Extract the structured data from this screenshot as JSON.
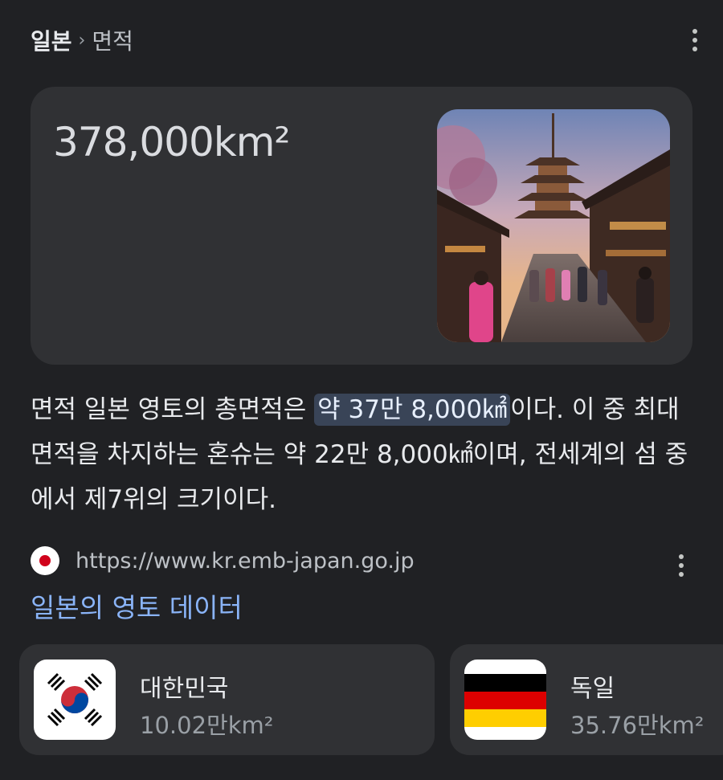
{
  "breadcrumb": {
    "root": "일본",
    "separator": "›",
    "current": "면적"
  },
  "hero": {
    "value": "378,000km²",
    "image_alt": "교토 야사카 탑 거리 사진"
  },
  "snippet": {
    "before": "면적 일본 영토의 총면적은 ",
    "highlight": "약 37만 8,000㎢",
    "after": "이다. 이 중 최대 면적을 차지하는 혼슈는 약 22만 8,000㎢이며, 전세계의 섬 중에서 제7위의 크기이다."
  },
  "source": {
    "url": "https://www.kr.emb-japan.go.jp"
  },
  "data_link": "일본의 영토 데이터",
  "related": [
    {
      "name": "대한민국",
      "area": "10.02만km²",
      "flag": "south-korea-flag"
    },
    {
      "name": "독일",
      "area": "35.76만km²",
      "flag": "germany-flag"
    }
  ],
  "colors": {
    "background": "#202124",
    "card": "#303134",
    "link": "#8ab4f8",
    "highlight": "#394457"
  }
}
